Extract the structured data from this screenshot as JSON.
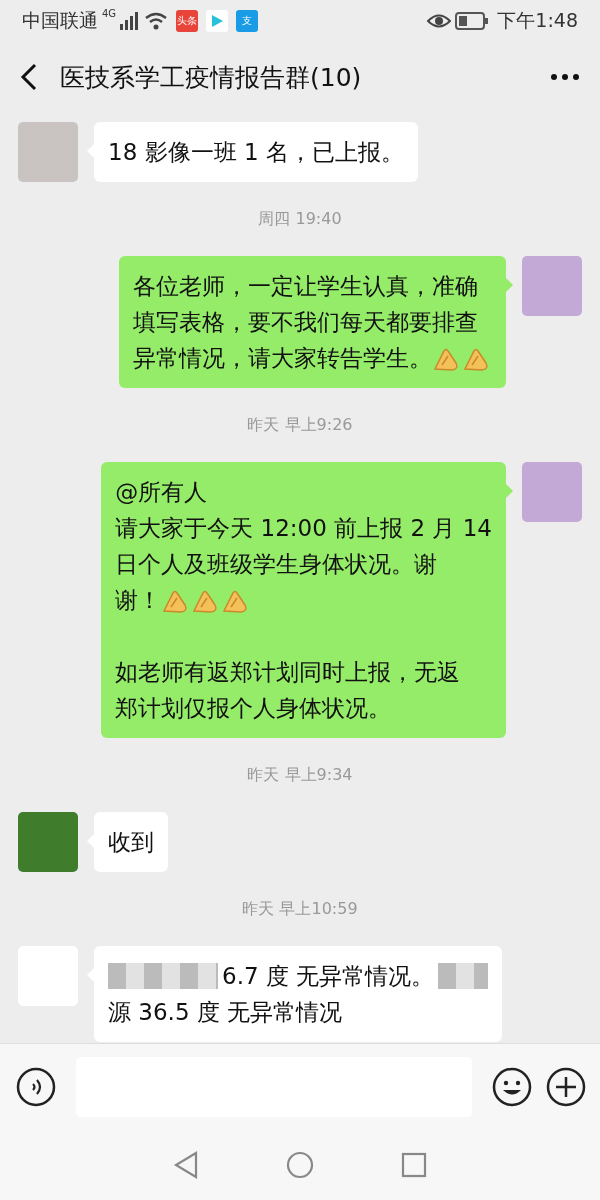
{
  "status_bar": {
    "carrier": "中国联通",
    "network": "4G",
    "apps": [
      {
        "kind": "badge",
        "label": "头条",
        "color": "#e8443a"
      },
      {
        "kind": "play",
        "color": "#ffffff"
      },
      {
        "kind": "badge",
        "label": "支",
        "color": "#1a9be6"
      }
    ],
    "time": "下午1:48"
  },
  "header": {
    "title": "医技系学工疫情报告群(10)"
  },
  "chat": [
    {
      "kind": "message",
      "own": false,
      "avatar": {
        "color": "#c9c4c2"
      },
      "lines": [
        [
          {
            "kind": "text",
            "text": "18 影像一班 1 名，已上报。"
          }
        ]
      ]
    },
    {
      "kind": "time",
      "text": "周四 19:40"
    },
    {
      "kind": "message",
      "own": true,
      "avatar": {
        "color": "#c3a9d6"
      },
      "lines": [
        [
          {
            "kind": "text",
            "text": "各位老师，一定让学生认真，准确"
          }
        ],
        [
          {
            "kind": "text",
            "text": "填写表格，要不我们每天都要排查"
          }
        ],
        [
          {
            "kind": "text",
            "text": "异常情况，请大家转告学生。"
          },
          {
            "kind": "emoji"
          },
          {
            "kind": "emoji"
          }
        ]
      ]
    },
    {
      "kind": "time",
      "text": "昨天 早上9:26"
    },
    {
      "kind": "message",
      "own": true,
      "avatar": {
        "color": "#c3a9d6"
      },
      "lines": [
        [
          {
            "kind": "text",
            "text": "@所有人"
          }
        ],
        [
          {
            "kind": "text",
            "text": "请大家于今天 12:00 前上报 2 月 14"
          }
        ],
        [
          {
            "kind": "text",
            "text": "日个人及班级学生身体状况。谢"
          }
        ],
        [
          {
            "kind": "text",
            "text": "谢！"
          },
          {
            "kind": "emoji"
          },
          {
            "kind": "emoji"
          },
          {
            "kind": "emoji"
          }
        ],
        [
          {
            "kind": "blank"
          }
        ],
        [
          {
            "kind": "text",
            "text": "如老师有返郑计划同时上报，无返"
          }
        ],
        [
          {
            "kind": "text",
            "text": "郑计划仅报个人身体状况。"
          }
        ]
      ]
    },
    {
      "kind": "time",
      "text": "昨天 早上9:34"
    },
    {
      "kind": "message",
      "own": false,
      "avatar": {
        "color": "#3f7d2c"
      },
      "lines": [
        [
          {
            "kind": "text",
            "text": "收到"
          }
        ]
      ]
    },
    {
      "kind": "time",
      "text": "昨天 早上10:59"
    },
    {
      "kind": "message",
      "own": false,
      "avatar": {
        "color": "#ffffff"
      },
      "lines": [
        [
          {
            "kind": "blur"
          },
          {
            "kind": "text",
            "text": "6.7 度 无异常情况。"
          },
          {
            "kind": "blur"
          }
        ],
        [
          {
            "kind": "text",
            "text": "源 36.5 度 无异常情况"
          }
        ]
      ]
    }
  ]
}
